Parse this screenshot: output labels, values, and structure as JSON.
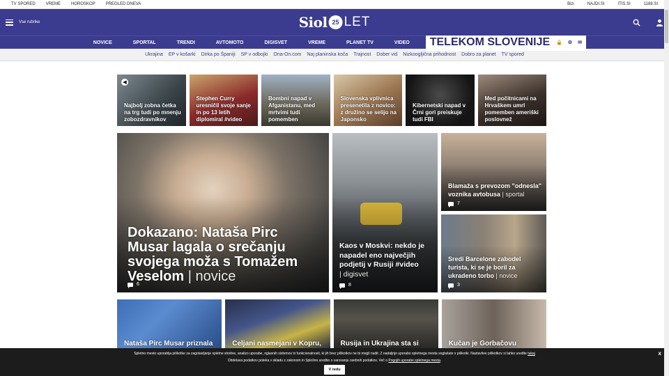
{
  "topbar": {
    "left": [
      "TV SPORED",
      "VREME",
      "HOROSKOP",
      "PREGLED DNEVA"
    ],
    "right": [
      "Bizi",
      "NAJDI.SI",
      "ITIS.SI",
      "1188.SI"
    ]
  },
  "header": {
    "menu_label": "Vse rubrike",
    "logo_word": "Siol",
    "logo_badge": "25",
    "logo_suffix": "LET"
  },
  "nav": {
    "items": [
      "NOVICE",
      "SPORTAL",
      "TRENDI",
      "AVTOMOTO",
      "DIGISVET",
      "VREME",
      "PLANET TV",
      "VIDEO"
    ],
    "telekom": "TELEKOM SLOVENIJE"
  },
  "subnav": [
    "Ukrajina",
    "EP v košarki",
    "Dirka po Španiji",
    "SP v odbojki",
    "Ona-On.com",
    "Naj planinska koča",
    "Trajnost",
    "Dober vid",
    "Nizkoogljična prihodnost",
    "Dobro za planet",
    "TV spored"
  ],
  "row1": [
    {
      "title": "Najbolj zobna četka na trg tudi po mnenju zobozdravnikov"
    },
    {
      "title": "Stephen Curry uresničil svoje sanje in po 13 letih diplomiral #video"
    },
    {
      "title": "Bombni napad v Afganistanu, med mrtvimi tudi pomemben"
    },
    {
      "title": "Slovenska vplivnica presenetila z novico: z družino se selijo na Japonsko"
    },
    {
      "title": "Kibernetski napad v Črni gori preiskuje tudi FBI"
    },
    {
      "title": "Med počitnicami na Hrvaškem umrl pomemben ameriški poslovnež"
    }
  ],
  "lead": {
    "title": "Dokazano: Nataša Pirc Musar lagala o srečanju svojega moža s Tomažem Veselom",
    "category": "novice",
    "comments": "6"
  },
  "mid": {
    "title": "Kaos v Moskvi: nekdo je napadel eno največjih podjetij v Rusiji #video",
    "category": "digisvet",
    "comments": "8"
  },
  "small1": {
    "title": "Blamaža s prevozom \"odnesla\" voznika avtobusa",
    "category": "sportal",
    "comments": "7"
  },
  "small2": {
    "title": "Sredi Barcelone zabodel turista, ki se je boril za ukradeno torbo",
    "category": "novice",
    "comments": "3"
  },
  "row3": [
    {
      "title": "Nataša Pirc Musar priznala"
    },
    {
      "title": "Celjani nasmejani v Kopru, v"
    },
    {
      "title": "Rusija in Ukrajina sta si"
    },
    {
      "title": "Kučan je Gorbačovu povedal,"
    }
  ],
  "cookie": {
    "line1": "Spletno mesto uporablja piškotke za zagotavljanje spletne storitve, analizo uporabe, oglasnih sistemov in funkcionalnosti, ki jih brez piškotkov ne bi mogli nudit. Z nadaljnjo uporabo spletnega mesta soglašate s piškotki. Nastavitve piškotkov si lahko uredite",
    "line1_link": "tukaj",
    "line2": "Obdelava podatkov poteka v skladu z zakonom in Splošno uredbo o varovanju osebnih podatkov. Več o",
    "line2_link": "Pogojih uporabe spletnega mesta",
    "accept": "V redu",
    "close": "x"
  }
}
